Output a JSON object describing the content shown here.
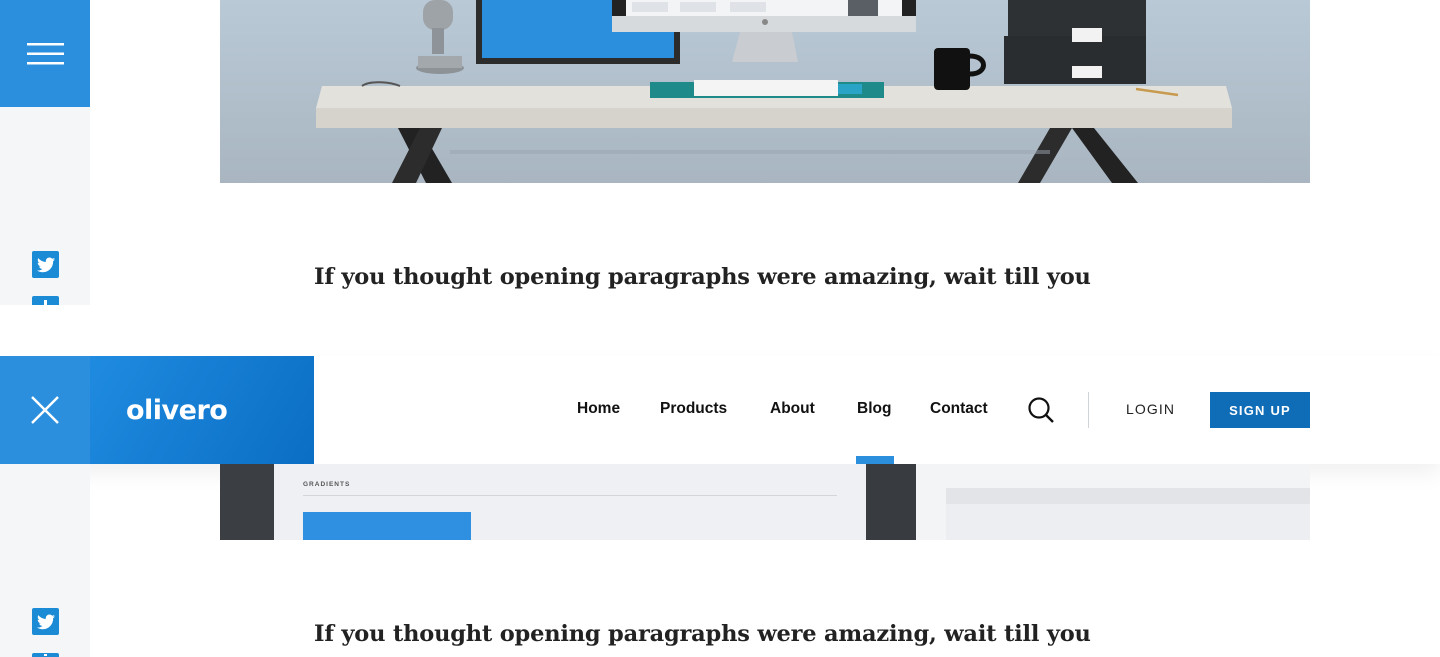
{
  "sidebar": {
    "menu_icon": "hamburger-icon",
    "close_icon": "close-icon",
    "social_icons": [
      "twitter-icon",
      "linkedin-icon"
    ]
  },
  "header": {
    "logo": "olivero",
    "nav": [
      {
        "label": "Home"
      },
      {
        "label": "Products"
      },
      {
        "label": "About"
      },
      {
        "label": "Blog",
        "active": true
      },
      {
        "label": "Contact"
      }
    ],
    "search_icon": "search-icon",
    "login_label": "LOGIN",
    "signup_label": "SIGN UP"
  },
  "content": {
    "paragraph_top": "If you thought opening paragraphs were amazing, wait till you",
    "paragraph_bottom": "If you thought opening paragraphs were amazing, wait till you",
    "mock_label": "GRADIENTS"
  },
  "colors": {
    "brand_blue": "#2b8fde",
    "signup_blue": "#0f6cb6",
    "twitter_blue": "#1b8bd6",
    "rail_bg": "#f5f6f8"
  }
}
